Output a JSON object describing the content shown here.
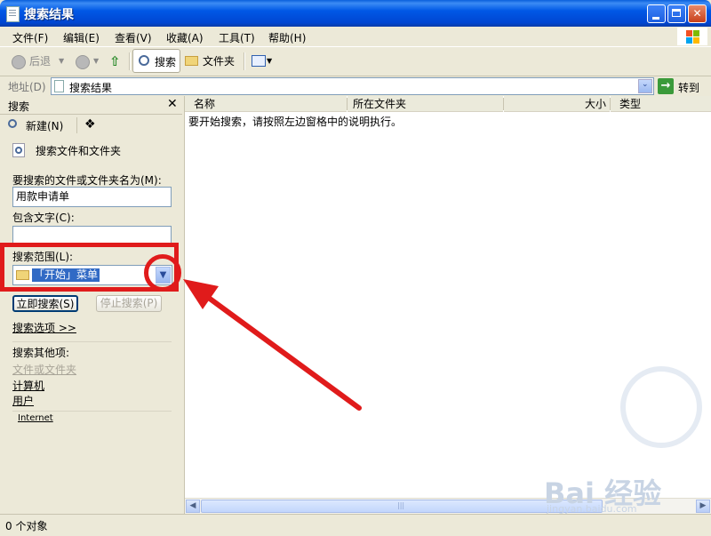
{
  "window": {
    "title": "搜索结果"
  },
  "menu": [
    {
      "label": "文件(F)"
    },
    {
      "label": "编辑(E)"
    },
    {
      "label": "查看(V)"
    },
    {
      "label": "收藏(A)"
    },
    {
      "label": "工具(T)"
    },
    {
      "label": "帮助(H)"
    }
  ],
  "toolbar": {
    "back_label": "后退",
    "search_label": "搜索",
    "folders_label": "文件夹"
  },
  "address": {
    "label": "地址(D)",
    "value": "搜索结果",
    "go_label": "转到"
  },
  "search_pane": {
    "title": "搜索",
    "new_label": "新建(N)",
    "section_title": "搜索文件和文件夹",
    "name_label": "要搜索的文件或文件夹名为(M):",
    "name_value": "用款申请单",
    "text_label": "包含文字(C):",
    "text_value": "",
    "scope_label": "搜索范围(L):",
    "scope_value": "「开始」菜单",
    "search_now": "立即搜索(S)",
    "stop_search": "停止搜索(P)",
    "options_link": "搜索选项 >>",
    "other_title": "搜索其他项:",
    "other_items": [
      "文件或文件夹",
      "计算机",
      "用户"
    ],
    "internet_link": "Internet"
  },
  "list": {
    "columns": [
      "名称",
      "所在文件夹",
      "大小",
      "类型"
    ],
    "hint": "要开始搜索，请按照左边窗格中的说明执行。"
  },
  "status": {
    "text": "0 个对象"
  },
  "watermark": {
    "text": "Bai 经验",
    "sub": "jingyan.baidu.com"
  },
  "colors": {
    "title_blue": "#0058e6",
    "annotation_red": "#e01b1b",
    "selection_blue": "#316ac5"
  }
}
